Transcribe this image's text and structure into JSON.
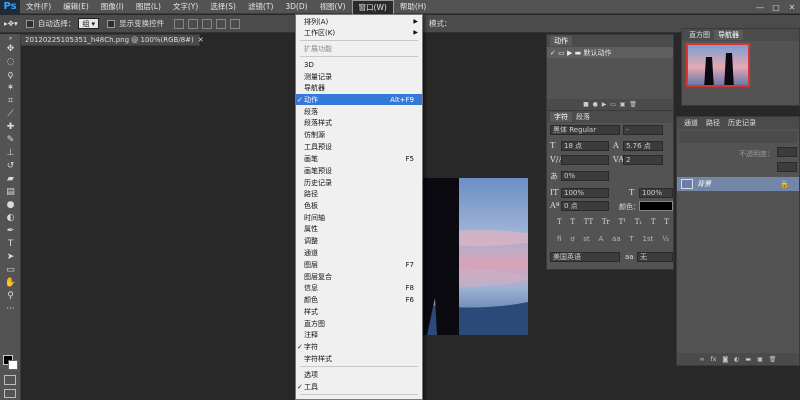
{
  "app": {
    "logo": "Ps"
  },
  "menubar": {
    "items": [
      "文件(F)",
      "编辑(E)",
      "图像(I)",
      "图层(L)",
      "文字(Y)",
      "选择(S)",
      "滤镜(T)",
      "3D(D)",
      "视图(V)",
      "窗口(W)",
      "帮助(H)"
    ],
    "window_controls": [
      "—",
      "□",
      "✕"
    ]
  },
  "options": {
    "auto_select_label": "自动选择：",
    "auto_select_value": "组",
    "show_transform_label": "显示变换控件",
    "mode_3d_label": "模式："
  },
  "document": {
    "tab_title": "20120225105351_h48Ch.png @ 100%(RGB/8#)"
  },
  "window_menu": {
    "items": [
      {
        "label": "排列(A)",
        "arrow": "▶"
      },
      {
        "label": "工作区(K)",
        "arrow": "▶"
      },
      {
        "label": "扩展功能",
        "disabled": true
      },
      {
        "label": "3D"
      },
      {
        "label": "测量记录"
      },
      {
        "label": "导航器"
      },
      {
        "label": "动作",
        "shortcut": "Alt+F9",
        "checked": true,
        "highlight": true
      },
      {
        "label": "段落"
      },
      {
        "label": "段落样式"
      },
      {
        "label": "仿制源"
      },
      {
        "label": "工具预设"
      },
      {
        "label": "画笔",
        "shortcut": "F5"
      },
      {
        "label": "画笔预设"
      },
      {
        "label": "历史记录"
      },
      {
        "label": "路径"
      },
      {
        "label": "色板"
      },
      {
        "label": "时间轴"
      },
      {
        "label": "属性"
      },
      {
        "label": "调整"
      },
      {
        "label": "通道"
      },
      {
        "label": "图层",
        "shortcut": "F7"
      },
      {
        "label": "图层复合"
      },
      {
        "label": "信息",
        "shortcut": "F8"
      },
      {
        "label": "颜色",
        "shortcut": "F6"
      },
      {
        "label": "样式"
      },
      {
        "label": "直方图"
      },
      {
        "label": "注释"
      },
      {
        "label": "字符",
        "checked": true
      },
      {
        "label": "字符样式"
      },
      {
        "label": "选项"
      },
      {
        "label": "工具",
        "checked": true
      }
    ],
    "check_mark": "✓"
  },
  "actions_panel": {
    "tab": "动作",
    "set_name": "默认动作"
  },
  "histogram_panel": {
    "tabs": [
      "直方图",
      "导航器"
    ]
  },
  "character_panel": {
    "tabs": [
      "字符",
      "段落"
    ],
    "font_family": "黑体 Regular",
    "font_style": "-",
    "font_size": "18 点",
    "leading": "5.76 点",
    "kerning": "",
    "tracking": "2",
    "tsume": "0%",
    "vertical_scale": "100%",
    "horizontal_scale": "100%",
    "baseline_shift": "0 点",
    "color_label": "颜色：",
    "type_styles": [
      "T",
      "T",
      "TT",
      "Tr",
      "T¹",
      "T₁",
      "T",
      "T"
    ],
    "language": "美国英语",
    "antialias": "无"
  },
  "layers_panel": {
    "tabs": [
      "通道",
      "路径",
      "历史记录"
    ],
    "opacity_label": "不透明度：",
    "layer_name": "背景"
  },
  "colors": {
    "accent": "#3478d8",
    "panel": "#535353",
    "workspace": "#282828"
  }
}
